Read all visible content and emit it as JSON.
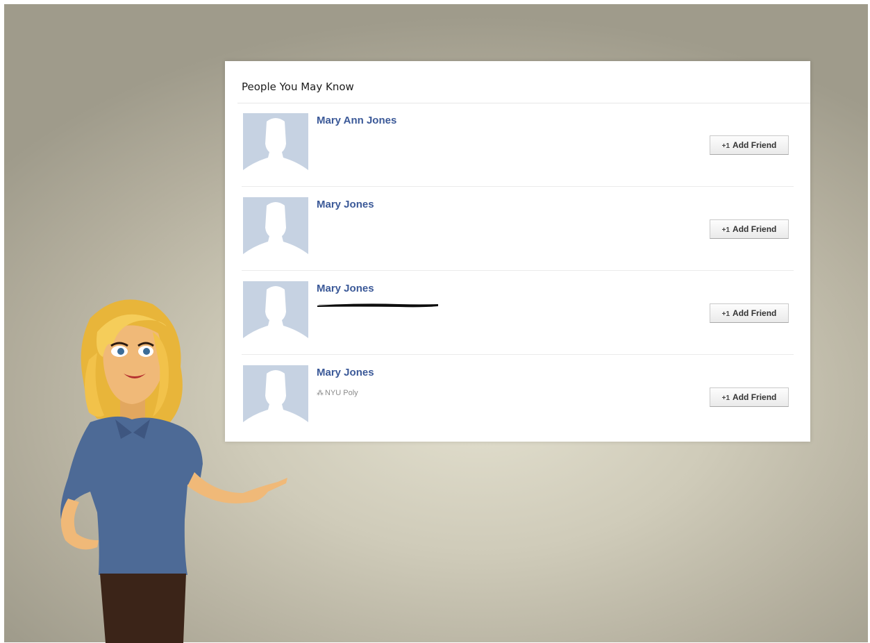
{
  "panel": {
    "title": "People You May Know"
  },
  "people": [
    {
      "name": "Mary Ann Jones",
      "network": "",
      "network_redacted": false,
      "button_label": "Add Friend"
    },
    {
      "name": "Mary Jones",
      "network": "",
      "network_redacted": false,
      "button_label": "Add Friend"
    },
    {
      "name": "Mary Jones",
      "network": "",
      "network_redacted": true,
      "button_label": "Add Friend"
    },
    {
      "name": "Mary Jones",
      "network": "NYU Poly",
      "network_redacted": false,
      "button_label": "Add Friend"
    }
  ],
  "icons": {
    "add_friend": "plus-person-icon",
    "network": "network-icon",
    "avatar": "default-silhouette"
  },
  "colors": {
    "name_link": "#3b5998",
    "avatar_bg": "#c6d2e2",
    "shirt": "#4d6a96",
    "hair": "#f2c24a"
  }
}
